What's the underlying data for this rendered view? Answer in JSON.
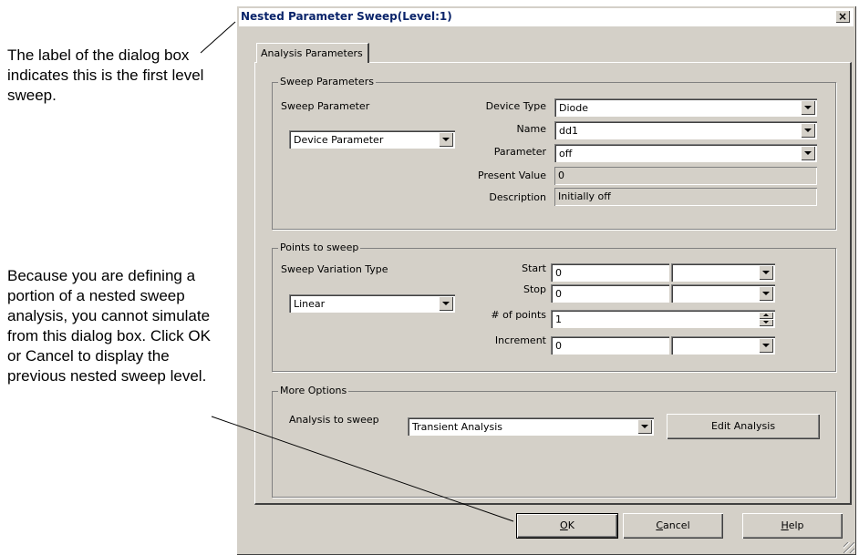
{
  "annotations": {
    "top": "The label of the dialog box indicates this is the first level sweep.",
    "bottom": "Because you are defining a portion of a nested sweep analysis, you cannot simulate from this dialog box. Click OK or Cancel to display the previous nested sweep level."
  },
  "dialog": {
    "title": "Nested Parameter Sweep(Level:1)",
    "close": "×",
    "tab": "Analysis Parameters"
  },
  "sweep_parameters": {
    "legend": "Sweep Parameters",
    "sweep_parameter_label": "Sweep Parameter",
    "sweep_parameter_value": "Device Parameter",
    "device_type_label": "Device Type",
    "device_type_value": "Diode",
    "name_label": "Name",
    "name_value": "dd1",
    "parameter_label": "Parameter",
    "parameter_value": "off",
    "present_value_label": "Present Value",
    "present_value": "0",
    "description_label": "Description",
    "description": "Initially off"
  },
  "points": {
    "legend": "Points to sweep",
    "variation_label": "Sweep Variation Type",
    "variation_value": "Linear",
    "start_label": "Start",
    "start_value": "0",
    "stop_label": "Stop",
    "stop_value": "0",
    "num_points_label": "# of points",
    "num_points_value": "1",
    "increment_label": "Increment",
    "increment_value": "0"
  },
  "more": {
    "legend": "More Options",
    "analysis_label": "Analysis to sweep",
    "analysis_value": "Transient Analysis",
    "edit_button": "Edit Analysis"
  },
  "buttons": {
    "ok_hot": "O",
    "ok_rest": "K",
    "cancel_hot": "C",
    "cancel_rest": "ancel",
    "help_hot": "H",
    "help_rest": "elp"
  }
}
